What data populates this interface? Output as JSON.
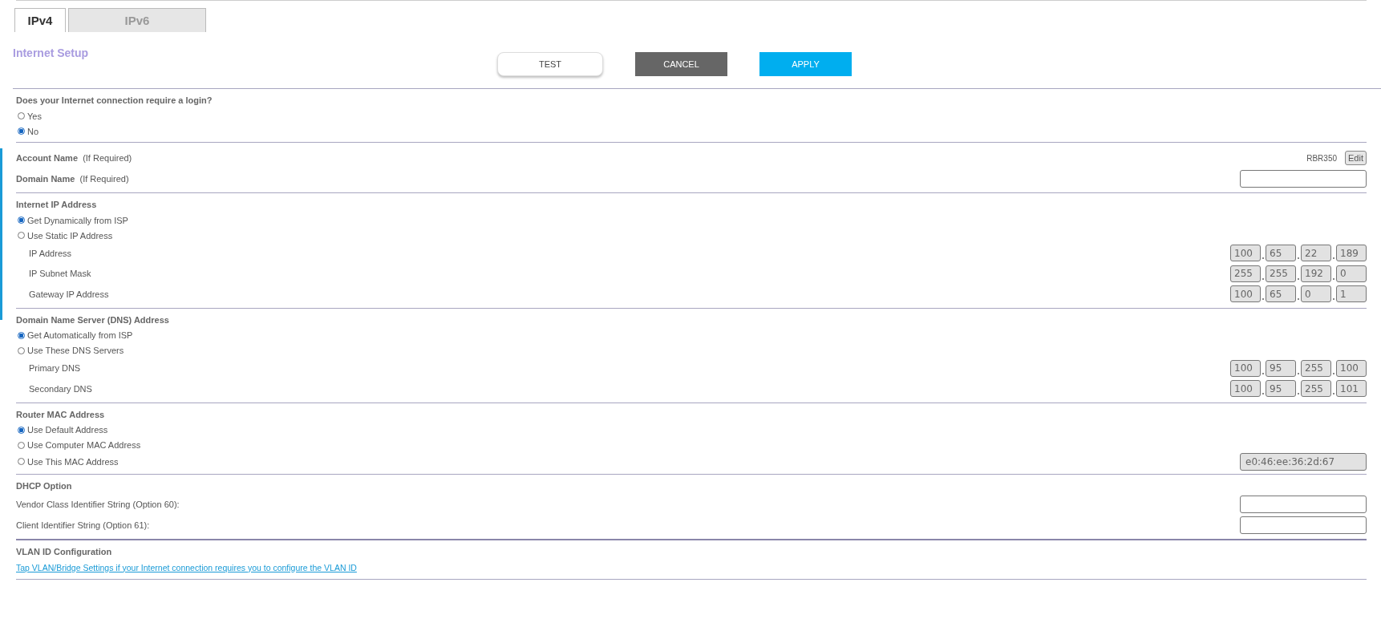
{
  "tabs": [
    {
      "label": "IPv4",
      "selected": true
    },
    {
      "label": "IPv6",
      "selected": false
    }
  ],
  "title": "Internet Setup",
  "buttons": [
    {
      "label": "TEST",
      "kind": "outline"
    },
    {
      "label": "CANCEL",
      "kind": "dark"
    },
    {
      "label": "APPLY",
      "kind": "primary"
    }
  ],
  "sections": [
    {
      "heading": "Does your Internet connection require a login?",
      "rows": [
        {
          "kind": "radio",
          "label": "Yes",
          "selected": false
        },
        {
          "kind": "radio",
          "label": "No",
          "selected": true
        }
      ]
    },
    {
      "rows": [
        {
          "kind": "value",
          "label": "Account Name",
          "note": "(If Required)",
          "value": "RBR350",
          "button": "Edit"
        },
        {
          "kind": "field",
          "label": "Domain Name",
          "note": "(If Required)",
          "disabled": false
        }
      ]
    },
    {
      "heading": "Internet IP Address",
      "rows": [
        {
          "kind": "radio",
          "label": "Get Dynamically from ISP",
          "selected": true
        },
        {
          "kind": "radio",
          "label": "Use Static IP Address",
          "selected": false
        },
        {
          "kind": "ip",
          "label": "IP Address",
          "octets": [
            "100",
            "65",
            "22",
            "189"
          ],
          "disabled": true
        },
        {
          "kind": "ip",
          "label": "IP Subnet Mask",
          "octets": [
            "255",
            "255",
            "192",
            "0"
          ],
          "disabled": true
        },
        {
          "kind": "ip",
          "label": "Gateway IP Address",
          "octets": [
            "100",
            "65",
            "0",
            "1"
          ],
          "disabled": true
        }
      ]
    },
    {
      "heading": "Domain Name Server (DNS) Address",
      "rows": [
        {
          "kind": "radio",
          "label": "Get Automatically from ISP",
          "selected": true
        },
        {
          "kind": "radio",
          "label": "Use These DNS Servers",
          "selected": false
        },
        {
          "kind": "ip",
          "label": "Primary DNS",
          "octets": [
            "100",
            "95",
            "255",
            "100"
          ],
          "disabled": true
        },
        {
          "kind": "ip",
          "label": "Secondary DNS",
          "octets": [
            "100",
            "95",
            "255",
            "101"
          ],
          "disabled": true
        }
      ]
    },
    {
      "heading": "Router MAC Address",
      "rows": [
        {
          "kind": "radio",
          "label": "Use Default Address",
          "selected": true
        },
        {
          "kind": "radio",
          "label": "Use Computer MAC Address",
          "selected": false
        },
        {
          "kind": "radio_field",
          "label": "Use This MAC Address",
          "selected": false,
          "value": "e0:46:ee:36:2d:67",
          "disabled": true
        }
      ]
    },
    {
      "heading": "DHCP Option",
      "rows": [
        {
          "kind": "field",
          "label": "Vendor Class Identifier String (Option 60):",
          "disabled": false
        },
        {
          "kind": "field",
          "label": "Client Identifier String (Option 61):",
          "disabled": false
        }
      ]
    },
    {
      "heading": "VLAN ID Configuration",
      "rows": [
        {
          "kind": "link",
          "label": "Tap VLAN/Bridge Settings if your Internet connection requires you to configure the VLAN ID"
        }
      ]
    }
  ]
}
